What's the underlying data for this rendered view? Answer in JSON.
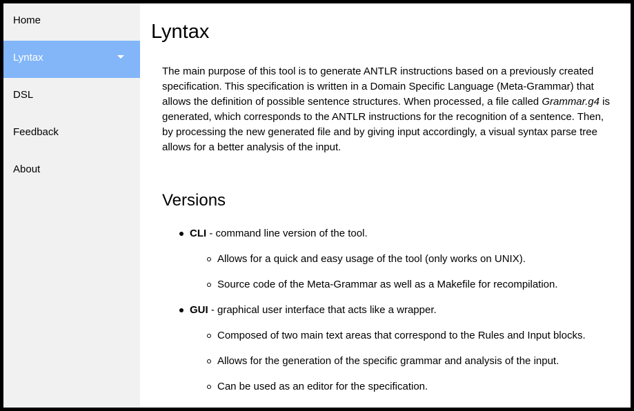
{
  "sidebar": {
    "items": [
      {
        "label": "Home"
      },
      {
        "label": "Lyntax",
        "active": true,
        "icon": "caret-down-icon"
      },
      {
        "label": "DSL"
      },
      {
        "label": "Feedback"
      },
      {
        "label": "About"
      }
    ]
  },
  "colors": {
    "active_bg": "#82b6f9",
    "sidebar_bg": "#f1f1f1"
  },
  "main": {
    "title": "Lyntax",
    "intro": {
      "before": "The main purpose of this tool is to generate ANTLR instructions based on a previously created specification. This specification is written in a Domain Specific Language (Meta-Grammar) that allows the definition of possible sentence structures. When processed, a file called ",
      "filename": "Grammar.g4",
      "after": " is generated, which corresponds to the ANTLR instructions for the recognition of a sentence. Then, by processing the new generated file and by giving input accordingly, a visual syntax parse tree allows for a better analysis of the input."
    },
    "versions": {
      "heading": "Versions",
      "items": [
        {
          "name": "CLI",
          "desc": " - command line version of the tool.",
          "sub": [
            "Allows for a quick and easy usage of the tool (only works on UNIX).",
            "Source code of the Meta-Grammar as well as a Makefile for recompilation."
          ]
        },
        {
          "name": "GUI",
          "desc": " - graphical user interface that acts like a wrapper.",
          "sub": [
            "Composed of two main text areas that correspond to the Rules and Input blocks.",
            "Allows for the generation of the specific grammar and analysis of the input.",
            "Can be used as an editor for the specification."
          ]
        }
      ]
    }
  }
}
